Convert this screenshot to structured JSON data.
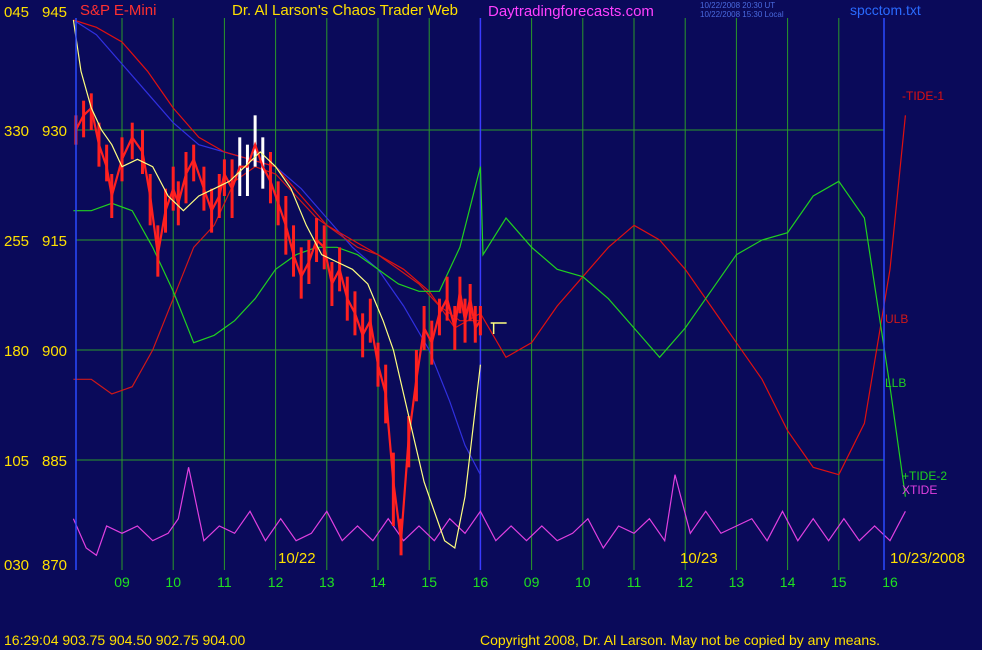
{
  "header": {
    "title_left": "S&P E-Mini",
    "title_center": "Dr. Al Larson's Chaos Trader Web",
    "site": "Daytradingforecasts.com",
    "stamp_line1": "10/22/2008 20:30 UT",
    "stamp_line2": "10/22/2008 15:30 Local",
    "filename": "spcctom.txt"
  },
  "footer": {
    "quote": "16:29:04  903.75  904.50  902.75  904.00",
    "copyright": "Copyright 2008, Dr. Al Larson. May not be copied by any means."
  },
  "colors": {
    "background": "#0a0a5a",
    "grid": "#2a9a2a",
    "price": "#ff2020",
    "fast_avg": "#ffff80",
    "slow_avg": "#3030e0",
    "tide1": "#e01010",
    "ulb": "#d01818",
    "llb": "#20d020",
    "tide2": "#20d020",
    "xtide": "#e040e0",
    "axis_text": "#ffe000",
    "hour_text": "#20e020"
  },
  "chart_data": {
    "type": "line",
    "title": "S&P E-Mini",
    "y_left_ticks": [
      "045",
      "330",
      "255",
      "180",
      "105",
      "030"
    ],
    "y_price_ticks": [
      "945",
      "930",
      "915",
      "900",
      "885",
      "870"
    ],
    "y_price_values": [
      945,
      930,
      915,
      900,
      885,
      870
    ],
    "ylim": [
      870,
      945
    ],
    "hours": [
      "09",
      "10",
      "11",
      "12",
      "13",
      "14",
      "15",
      "16",
      "09",
      "10",
      "11",
      "12",
      "13",
      "14",
      "15",
      "16"
    ],
    "date_labels": [
      "10/22",
      "10/23",
      "10/23/2008"
    ],
    "hour_index_range": [
      0,
      15.3
    ],
    "current_index": 7,
    "series_labels": [
      "-TIDE-1",
      "ULB",
      "LLB",
      "+TIDE-2",
      "XTIDE"
    ],
    "marker": "T",
    "series": [
      {
        "name": "price",
        "x": [
          -0.9,
          -0.75,
          -0.6,
          -0.45,
          -0.3,
          -0.2,
          0,
          0.2,
          0.4,
          0.55,
          0.7,
          0.85,
          1.0,
          1.1,
          1.25,
          1.4,
          1.6,
          1.75,
          1.9,
          2.0,
          2.15,
          2.3,
          2.45,
          2.6,
          2.75,
          2.9,
          3.05,
          3.2,
          3.35,
          3.5,
          3.65,
          3.8,
          3.95,
          4.1,
          4.25,
          4.4,
          4.55,
          4.7,
          4.85,
          5.0,
          5.15,
          5.3,
          5.45,
          5.6,
          5.75,
          5.9,
          6.05,
          6.2,
          6.35,
          6.5,
          6.6,
          6.7,
          6.8,
          6.9,
          7.0
        ],
        "y": [
          930,
          932,
          933,
          928,
          925,
          921,
          926,
          929,
          927,
          921,
          913,
          919,
          922,
          920,
          924,
          926,
          922,
          919,
          921,
          924,
          922,
          925,
          925,
          928,
          925,
          923,
          920,
          917,
          913,
          910,
          912,
          915,
          914,
          909,
          911,
          907,
          905,
          902,
          904,
          898,
          894,
          882,
          874,
          888,
          896,
          903,
          901,
          905,
          907,
          903,
          908,
          904,
          907,
          903,
          904
        ],
        "high": [
          932,
          934,
          935,
          931,
          928,
          924,
          929,
          931,
          930,
          924,
          917,
          922,
          925,
          923,
          927,
          928,
          925,
          922,
          924,
          926,
          926,
          929,
          928,
          932,
          929,
          927,
          923,
          921,
          917,
          914,
          915,
          918,
          917,
          912,
          914,
          910,
          908,
          905,
          907,
          901,
          898,
          886,
          877,
          891,
          900,
          906,
          904,
          907,
          910,
          906,
          910,
          907,
          909,
          906,
          906
        ],
        "low": [
          928,
          929,
          930,
          925,
          923,
          918,
          923,
          926,
          924,
          917,
          910,
          916,
          919,
          917,
          920,
          923,
          919,
          916,
          918,
          921,
          918,
          921,
          921,
          925,
          922,
          920,
          917,
          913,
          910,
          907,
          909,
          912,
          911,
          906,
          908,
          904,
          902,
          899,
          901,
          895,
          890,
          876,
          872,
          884,
          893,
          900,
          898,
          902,
          904,
          900,
          905,
          901,
          904,
          901,
          902
        ]
      },
      {
        "name": "fast",
        "x": [
          -0.95,
          -0.8,
          -0.6,
          -0.4,
          -0.2,
          0,
          0.3,
          0.6,
          0.9,
          1.2,
          1.5,
          1.8,
          2.1,
          2.4,
          2.7,
          3.0,
          3.3,
          3.6,
          3.9,
          4.2,
          4.5,
          4.8,
          5.1,
          5.3,
          5.5,
          5.7,
          5.9,
          6.1,
          6.3,
          6.5,
          6.7,
          6.9,
          7.0
        ],
        "y": [
          945,
          938,
          933,
          930,
          928,
          925,
          926,
          925,
          921,
          919,
          921,
          922,
          923,
          925,
          927,
          925,
          922,
          917,
          913,
          912,
          911,
          909,
          904,
          900,
          894,
          888,
          882,
          878,
          874,
          873,
          880,
          892,
          898
        ]
      },
      {
        "name": "slow",
        "x": [
          -0.95,
          -0.5,
          0,
          0.5,
          1.0,
          1.5,
          2.0,
          2.5,
          3.0,
          3.5,
          4.0,
          4.5,
          5.0,
          5.5,
          6.0,
          6.4,
          6.7,
          7.0
        ],
        "y": [
          945,
          943,
          939,
          935,
          931,
          928,
          927,
          926,
          925,
          922,
          918,
          914,
          911,
          906,
          900,
          893,
          887,
          883
        ]
      },
      {
        "name": "TIDE-1",
        "x": [
          -0.95,
          -0.5,
          0,
          0.5,
          1.0,
          1.5,
          2.0,
          2.5,
          3.0,
          3.5,
          4.0,
          4.5,
          5.0,
          5.5,
          6.0,
          6.5,
          7.0,
          7.5,
          8.0,
          8.5,
          9.0,
          9.5,
          10.0,
          10.5,
          11.0,
          11.5,
          12.0,
          12.5,
          13.0,
          13.5,
          14.0,
          14.5,
          15.0,
          15.3
        ],
        "y": [
          945,
          944,
          942,
          938,
          933,
          929,
          927,
          926,
          925,
          921,
          917,
          915,
          913,
          911,
          908,
          903,
          905,
          899,
          901,
          906,
          910,
          914,
          917,
          915,
          911,
          906,
          901,
          896,
          889,
          884,
          883,
          890,
          911,
          932
        ]
      },
      {
        "name": "ULB",
        "x": [
          -0.95,
          -0.6,
          -0.2,
          0.2,
          0.6,
          1.0,
          1.4,
          1.8,
          2.2,
          2.6,
          3.0,
          3.4,
          3.8,
          4.2,
          4.6,
          5.0,
          5.4,
          5.8,
          6.2,
          6.6,
          7.0
        ],
        "y": [
          896,
          896,
          894,
          895,
          900,
          907,
          914,
          917,
          923,
          925,
          924,
          921,
          918,
          916,
          914,
          913,
          911,
          909,
          906,
          904,
          904
        ]
      },
      {
        "name": "LLB",
        "x": [
          -0.95,
          -0.6,
          -0.2,
          0.2,
          0.6,
          1.0,
          1.4,
          1.8,
          2.2,
          2.6,
          3.0,
          3.4,
          3.8,
          4.2,
          4.6,
          5.0,
          5.4,
          5.8,
          6.2,
          6.6,
          7.0
        ],
        "y": [
          919,
          919,
          920,
          919,
          914,
          908,
          901,
          902,
          904,
          907,
          911,
          913,
          914,
          914,
          913,
          911,
          909,
          908,
          908,
          914,
          925
        ]
      },
      {
        "name": "TIDE-2",
        "x": [
          7.0,
          7.05,
          7.5,
          8.0,
          8.5,
          9.0,
          9.5,
          10.0,
          10.5,
          11.0,
          11.5,
          12.0,
          12.5,
          13.0,
          13.5,
          14.0,
          14.5,
          15.0,
          15.3
        ],
        "y": [
          925,
          913,
          918,
          914,
          911,
          910,
          907,
          903,
          899,
          903,
          908,
          913,
          915,
          916,
          921,
          923,
          918,
          895,
          880
        ]
      },
      {
        "name": "XTIDE",
        "x": [
          -0.95,
          -0.7,
          -0.5,
          -0.3,
          0,
          0.3,
          0.6,
          0.9,
          1.1,
          1.3,
          1.6,
          1.9,
          2.2,
          2.5,
          2.8,
          3.1,
          3.4,
          3.7,
          4.0,
          4.3,
          4.6,
          4.9,
          5.2,
          5.5,
          5.8,
          6.1,
          6.4,
          6.7,
          7.0,
          7.3,
          7.6,
          7.9,
          8.2,
          8.5,
          8.8,
          9.1,
          9.4,
          9.7,
          10.0,
          10.3,
          10.6,
          10.8,
          11.1,
          11.4,
          11.7,
          12.0,
          12.3,
          12.6,
          12.9,
          13.2,
          13.5,
          13.8,
          14.1,
          14.4,
          14.7,
          15.0,
          15.3
        ],
        "y": [
          877,
          873,
          872,
          876,
          875,
          876,
          874,
          875,
          877,
          884,
          874,
          876,
          875,
          878,
          874,
          877,
          874,
          875,
          878,
          874,
          876,
          874,
          877,
          874,
          876,
          874,
          877,
          875,
          878,
          874,
          876,
          874,
          876,
          874,
          875,
          877,
          873,
          876,
          875,
          877,
          874,
          883,
          875,
          878,
          875,
          876,
          877,
          874,
          878,
          874,
          877,
          874,
          877,
          874,
          876,
          874,
          878
        ]
      }
    ]
  }
}
